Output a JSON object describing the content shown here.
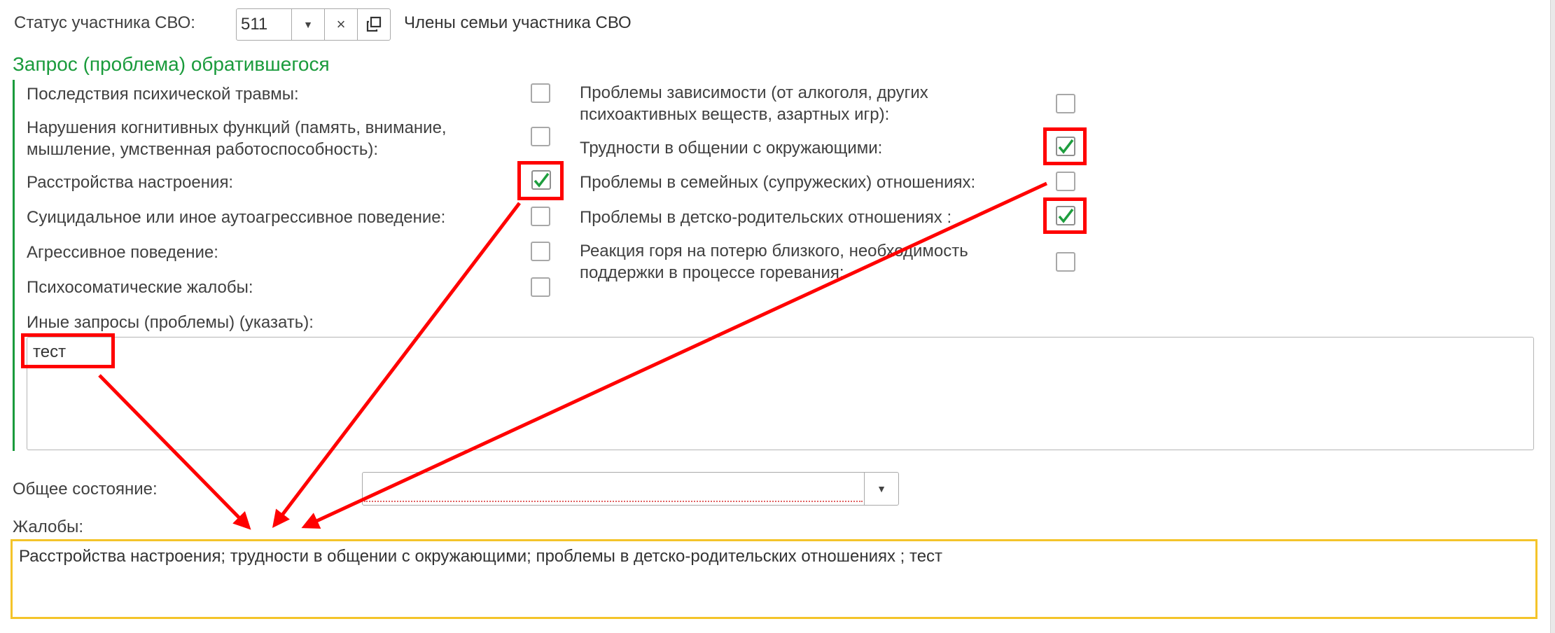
{
  "status": {
    "label": "Статус участника СВО:",
    "value": "511",
    "type_label": "Члены семьи участника СВО"
  },
  "request_group": {
    "title": "Запрос (проблема) обратившегося",
    "left_items": [
      {
        "label": "Последствия психической травмы:",
        "checked": false
      },
      {
        "label": "Нарушения когнитивных функций (память, внимание, мышление, умственная работоспособность):",
        "checked": false
      },
      {
        "label": "Расстройства настроения:",
        "checked": true
      },
      {
        "label": "Суицидальное или иное аутоагрессивное поведение:",
        "checked": false
      },
      {
        "label": "Агрессивное поведение:",
        "checked": false
      },
      {
        "label": "Психосоматические жалобы:",
        "checked": false
      }
    ],
    "right_items": [
      {
        "label": "Проблемы зависимости (от алкоголя, других психоактивных веществ, азартных игр):",
        "checked": false
      },
      {
        "label": "Трудности в общении с окружающими:",
        "checked": true
      },
      {
        "label": "Проблемы в семейных (супружеских) отношениях:",
        "checked": false
      },
      {
        "label": "Проблемы в детско-родительских отношениях :",
        "checked": true
      },
      {
        "label": "Реакция горя на потерю близкого, необходимость поддержки в процессе горевания:",
        "checked": false
      }
    ],
    "other_label": "Иные запросы (проблемы) (указать):",
    "other_value": "тест"
  },
  "general_state": {
    "label": "Общее состояние:",
    "value": ""
  },
  "complaints": {
    "label": "Жалобы:",
    "value": "Расстройства настроения; трудности в общении с окружающими; проблемы в детско-родительских отношениях ; тест"
  },
  "colors": {
    "accent_green": "#1a9b3c",
    "highlight_red": "#ff0000",
    "complaints_border": "#f4c42a",
    "check_green": "#1e9e3e"
  }
}
